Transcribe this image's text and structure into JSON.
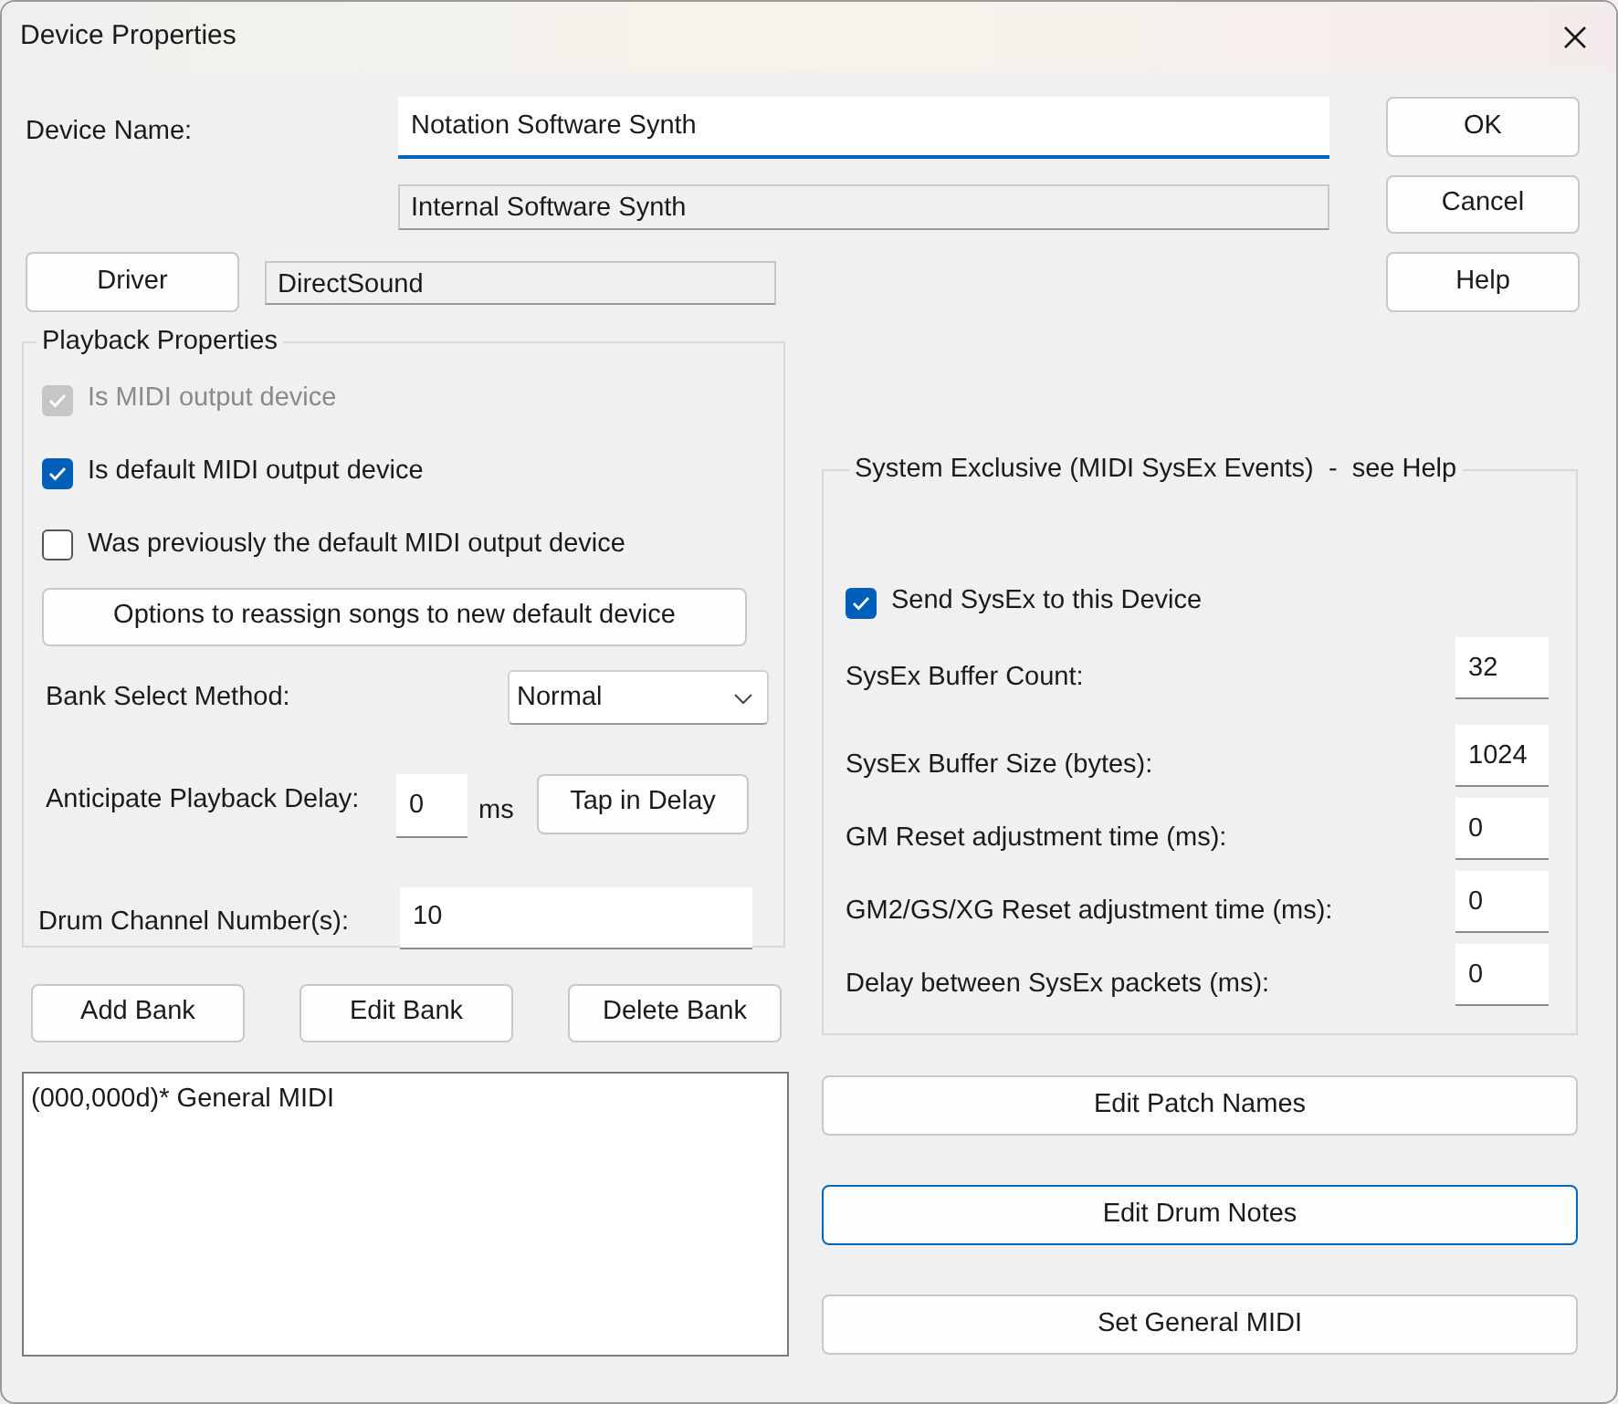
{
  "window": {
    "title": "Device Properties"
  },
  "device_name": {
    "label": "Device Name:",
    "value": "Notation Software Synth",
    "focused": true
  },
  "description": {
    "value": "Internal Software Synth"
  },
  "driver": {
    "button": "Driver",
    "value": "DirectSound"
  },
  "dialog_buttons": [
    {
      "label": "OK"
    },
    {
      "label": "Cancel"
    },
    {
      "label": "Help"
    }
  ],
  "playback": {
    "title": "Playback Properties",
    "checkboxes": [
      {
        "label": "Is MIDI output device",
        "checked": true,
        "disabled": true
      },
      {
        "label": "Is default MIDI output device",
        "checked": true,
        "disabled": false
      },
      {
        "label": "Was previously the default MIDI output device",
        "checked": false,
        "disabled": false
      }
    ],
    "reassign_button": "Options to reassign songs to new default device",
    "bank_select": {
      "label": "Bank Select Method:",
      "value": "Normal"
    },
    "anticipate": {
      "label": "Anticipate Playback Delay:",
      "value": "0",
      "unit": "ms",
      "button": "Tap in Delay"
    },
    "drum_channels": {
      "label": "Drum Channel Number(s):",
      "value": "10"
    }
  },
  "bank_buttons": [
    {
      "label": "Add Bank"
    },
    {
      "label": "Edit Bank"
    },
    {
      "label": "Delete Bank"
    }
  ],
  "banks": [
    {
      "label": "(000,000d)* General MIDI"
    }
  ],
  "sysex": {
    "title": "System Exclusive (MIDI SysEx Events)  -  see Help",
    "send": {
      "label": "Send SysEx to this Device",
      "checked": true
    },
    "fields": [
      {
        "label": "SysEx Buffer Count:",
        "value": "32"
      },
      {
        "label": "SysEx Buffer Size (bytes):",
        "value": "1024"
      },
      {
        "label": "GM Reset adjustment time (ms):",
        "value": "0"
      },
      {
        "label": "GM2/GS/XG Reset adjustment time (ms):",
        "value": "0"
      },
      {
        "label": "Delay between SysEx packets (ms):",
        "value": "0"
      }
    ]
  },
  "action_buttons": [
    {
      "label": "Edit Patch Names",
      "focused": false
    },
    {
      "label": "Edit Drum Notes",
      "focused": true
    },
    {
      "label": "Set General MIDI",
      "focused": false
    }
  ]
}
